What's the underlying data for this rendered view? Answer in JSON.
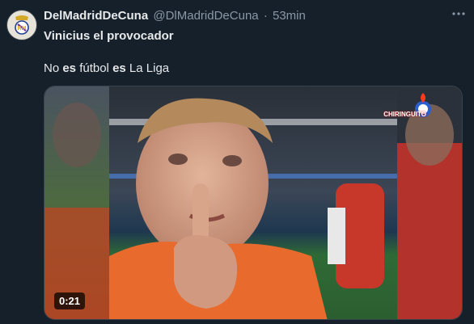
{
  "tweet": {
    "display_name": "DelMadridDeCuna",
    "handle": "@DlMadridDeCuna",
    "separator": "·",
    "time": "53min",
    "line1": "Vinicius el provocador",
    "line2": {
      "part1": "No ",
      "bold1": "es",
      "part2": " fútbol ",
      "bold2": "es",
      "part3": " La Liga"
    }
  },
  "media": {
    "duration": "0:21",
    "watermark": "CHIRINGUITO"
  },
  "icons": {
    "avatar": "real-madrid-crest-icon",
    "more": "more-options-icon"
  }
}
